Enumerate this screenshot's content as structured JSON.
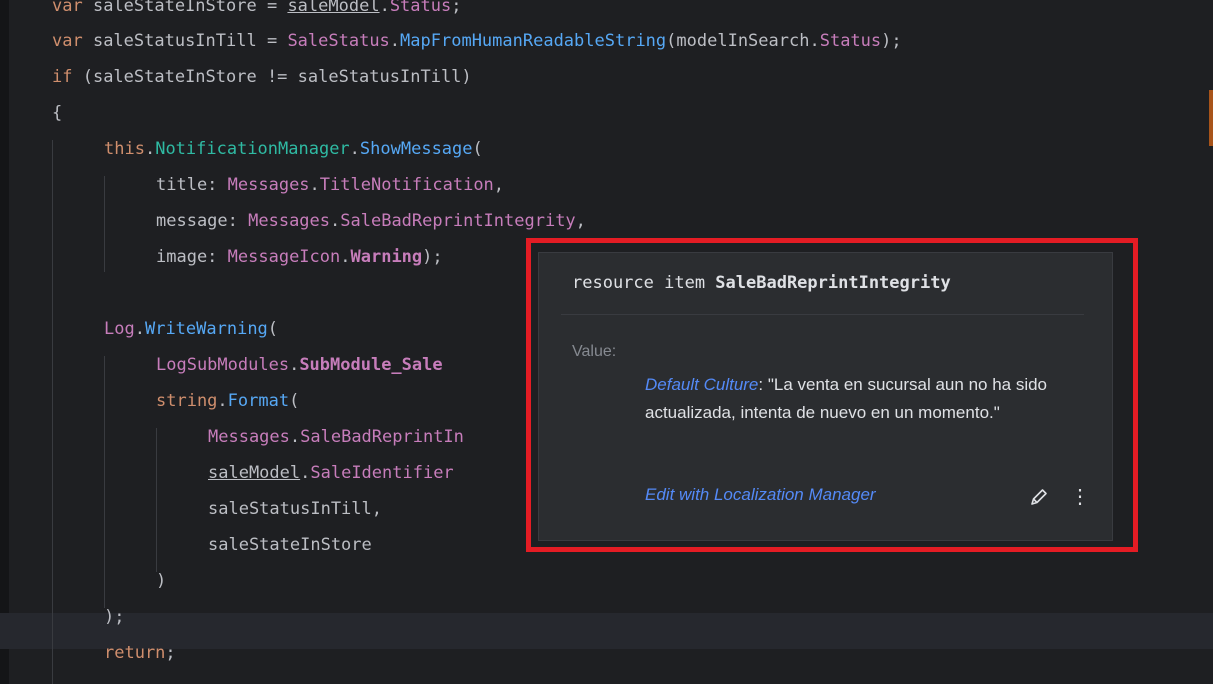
{
  "code_lines": [
    {
      "id": "l1",
      "parts": [
        {
          "t": "var ",
          "c": "kw"
        },
        {
          "t": "saleStateInStore",
          "c": "id"
        },
        {
          "t": " = ",
          "c": "punc"
        },
        {
          "t": "saleModel",
          "c": "id ul"
        },
        {
          "t": ".",
          "c": "punc"
        },
        {
          "t": "Status",
          "c": "member"
        },
        {
          "t": ";",
          "c": "punc"
        }
      ]
    },
    {
      "id": "l2",
      "parts": [
        {
          "t": "var ",
          "c": "kw"
        },
        {
          "t": "saleStatusInTill",
          "c": "id"
        },
        {
          "t": " = ",
          "c": "punc"
        },
        {
          "t": "SaleStatus",
          "c": "cls"
        },
        {
          "t": ".",
          "c": "punc"
        },
        {
          "t": "MapFromHumanReadableString",
          "c": "func"
        },
        {
          "t": "(",
          "c": "punc"
        },
        {
          "t": "modelInSearch",
          "c": "id"
        },
        {
          "t": ".",
          "c": "punc"
        },
        {
          "t": "Status",
          "c": "member"
        },
        {
          "t": ");",
          "c": "punc"
        }
      ]
    },
    {
      "id": "l3",
      "parts": [
        {
          "t": "if ",
          "c": "kw"
        },
        {
          "t": "(saleStateInStore != saleStatusInTill)",
          "c": "id"
        }
      ]
    },
    {
      "id": "l4",
      "parts": [
        {
          "t": "{",
          "c": "punc"
        }
      ]
    },
    {
      "id": "l5",
      "parts": [
        {
          "t": "this",
          "c": "kw"
        },
        {
          "t": ".",
          "c": "punc"
        },
        {
          "t": "NotificationManager",
          "c": "cyan"
        },
        {
          "t": ".",
          "c": "punc"
        },
        {
          "t": "ShowMessage",
          "c": "func"
        },
        {
          "t": "(",
          "c": "punc"
        }
      ]
    },
    {
      "id": "l6",
      "parts": [
        {
          "t": "title: ",
          "c": "id"
        },
        {
          "t": "Messages",
          "c": "cls"
        },
        {
          "t": ".",
          "c": "punc"
        },
        {
          "t": "TitleNotification",
          "c": "member"
        },
        {
          "t": ",",
          "c": "punc"
        }
      ]
    },
    {
      "id": "l7",
      "parts": [
        {
          "t": "message: ",
          "c": "id"
        },
        {
          "t": "Messages",
          "c": "cls"
        },
        {
          "t": ".",
          "c": "punc"
        },
        {
          "t": "SaleBadReprintIntegrity",
          "c": "member"
        },
        {
          "t": ",",
          "c": "punc"
        }
      ]
    },
    {
      "id": "l8",
      "parts": [
        {
          "t": "image: ",
          "c": "id"
        },
        {
          "t": "MessageIcon",
          "c": "cls"
        },
        {
          "t": ".",
          "c": "punc"
        },
        {
          "t": "Warning",
          "c": "member bold"
        },
        {
          "t": ");",
          "c": "punc"
        }
      ]
    },
    {
      "id": "l9",
      "parts": []
    },
    {
      "id": "l10",
      "parts": [
        {
          "t": "Log",
          "c": "cls"
        },
        {
          "t": ".",
          "c": "punc"
        },
        {
          "t": "WriteWarning",
          "c": "func"
        },
        {
          "t": "(",
          "c": "punc"
        }
      ]
    },
    {
      "id": "l11",
      "parts": [
        {
          "t": "LogSubModules",
          "c": "cls"
        },
        {
          "t": ".",
          "c": "punc"
        },
        {
          "t": "SubModule_Sale",
          "c": "member bold"
        }
      ]
    },
    {
      "id": "l12",
      "parts": [
        {
          "t": "string",
          "c": "kw"
        },
        {
          "t": ".",
          "c": "punc"
        },
        {
          "t": "Format",
          "c": "func"
        },
        {
          "t": "(",
          "c": "punc"
        }
      ]
    },
    {
      "id": "l13",
      "parts": [
        {
          "t": "Messages",
          "c": "cls"
        },
        {
          "t": ".",
          "c": "punc"
        },
        {
          "t": "SaleBadReprintIn",
          "c": "member"
        }
      ]
    },
    {
      "id": "l14",
      "parts": [
        {
          "t": "saleModel",
          "c": "id ul"
        },
        {
          "t": ".",
          "c": "punc"
        },
        {
          "t": "SaleIdentifier",
          "c": "member"
        }
      ]
    },
    {
      "id": "l15",
      "parts": [
        {
          "t": "saleStatusInTill,",
          "c": "id"
        }
      ]
    },
    {
      "id": "l16",
      "parts": [
        {
          "t": "saleStateInStore",
          "c": "id"
        }
      ]
    },
    {
      "id": "l17",
      "parts": [
        {
          "t": ")",
          "c": "punc"
        }
      ]
    },
    {
      "id": "l18",
      "parts": [
        {
          "t": ");",
          "c": "punc"
        }
      ]
    },
    {
      "id": "l19",
      "parts": [
        {
          "t": "return",
          "c": "kw"
        },
        {
          "t": ";",
          "c": "punc"
        }
      ]
    }
  ],
  "popup": {
    "title_prefix": "resource item ",
    "title_name": "SaleBadReprintIntegrity",
    "value_label": "Value:",
    "culture_label": "Default Culture",
    "culture_sep": ": ",
    "culture_value": "\"La venta en sucursal aun no ha sido actualizada, intenta de nuevo en un momento.\"",
    "edit_link": "Edit with Localization Manager",
    "more_glyph": "⋮"
  },
  "colors": {
    "background": "#1e1f22",
    "highlight_border": "#e41c24",
    "link": "#548af7"
  }
}
